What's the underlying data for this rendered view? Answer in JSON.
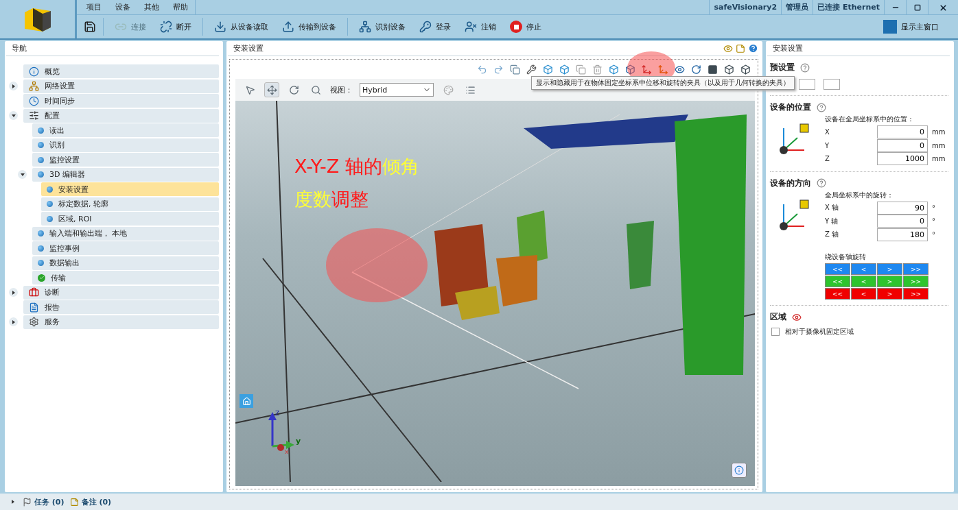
{
  "menu": [
    "项目",
    "设备",
    "其他",
    "帮助"
  ],
  "toolbar": [
    {
      "label": "连接",
      "disabled": true
    },
    {
      "label": "断开",
      "disabled": false
    },
    {
      "label": "从设备读取",
      "disabled": false
    },
    {
      "label": "传输到设备",
      "disabled": false
    },
    {
      "label": "识别设备",
      "disabled": false
    },
    {
      "label": "登录",
      "disabled": false
    },
    {
      "label": "注销",
      "disabled": false
    },
    {
      "label": "停止",
      "disabled": false
    }
  ],
  "status_cells": [
    "safeVisionary2",
    "管理员",
    "已连接 Ethernet"
  ],
  "show_main_window": "显示主窗口",
  "navigation": {
    "title": "导航",
    "items": [
      {
        "kind": "overview",
        "label": "概览",
        "selected": false
      },
      {
        "kind": "network",
        "label": "网络设置",
        "selected": false,
        "expanded": false
      },
      {
        "kind": "clock",
        "label": "时间同步",
        "selected": false
      },
      {
        "kind": "config",
        "label": "配置",
        "selected": false,
        "expanded": true,
        "children": [
          {
            "kind": "step",
            "label": "读出",
            "selected": false
          },
          {
            "kind": "step",
            "label": "识别",
            "selected": false
          },
          {
            "kind": "step",
            "label": "监控设置",
            "selected": false
          },
          {
            "kind": "step",
            "label": "3D 编辑器",
            "selected": false,
            "expanded": true,
            "children": [
              {
                "kind": "step",
                "label": "安装设置",
                "selected": true
              },
              {
                "kind": "step",
                "label": "标定数据, 轮廓",
                "selected": false
              },
              {
                "kind": "step",
                "label": "区域, ROI",
                "selected": false
              }
            ]
          },
          {
            "kind": "step",
            "label": "输入端和输出端， 本地",
            "selected": false
          },
          {
            "kind": "step",
            "label": "监控事例",
            "selected": false
          },
          {
            "kind": "step",
            "label": "数据输出",
            "selected": false
          },
          {
            "kind": "done",
            "label": "传输",
            "selected": false
          }
        ]
      },
      {
        "kind": "diagnose",
        "label": "诊断",
        "selected": false,
        "expanded": false
      },
      {
        "kind": "report",
        "label": "报告",
        "selected": false
      },
      {
        "kind": "service",
        "label": "服务",
        "selected": false,
        "expanded": false
      }
    ]
  },
  "editor": {
    "title": "安装设置",
    "view_label": "视图：",
    "view_value": "Hybrid",
    "tooltip": "显示和隐藏用于在物体固定坐标系中位移和旋转的夹具（以及用于几何转换的夹具）",
    "annotation": [
      [
        {
          "text": "X-Y-Z 轴的",
          "color": "#ff1a1a"
        },
        {
          "text": "倾角",
          "color": "#ffff33"
        }
      ],
      [
        {
          "text": "度数",
          "color": "#ffff33"
        },
        {
          "text": "调整",
          "color": "#ff1a1a"
        }
      ]
    ],
    "gizmo_labels": [
      "Z",
      "y",
      "x"
    ]
  },
  "settings": {
    "title": "安装设置",
    "preset": {
      "title": "预设置"
    },
    "position": {
      "title": "设备的位置",
      "caption": "设备在全局坐标系中的位置：",
      "fields": [
        {
          "label": "X",
          "value": "0",
          "unit": "mm"
        },
        {
          "label": "Y",
          "value": "0",
          "unit": "mm"
        },
        {
          "label": "Z",
          "value": "1000",
          "unit": "mm"
        }
      ]
    },
    "orientation": {
      "title": "设备的方向",
      "caption": "全局坐标系中的旋转：",
      "fields": [
        {
          "label": "X 轴",
          "value": "90",
          "unit": "°"
        },
        {
          "label": "Y 轴",
          "value": "0",
          "unit": "°"
        },
        {
          "label": "Z 轴",
          "value": "180",
          "unit": "°"
        }
      ],
      "rotate_caption": "绕设备轴旋转",
      "rotate_rows": [
        {
          "color": "#1e88f0",
          "buttons": [
            "<<",
            "<",
            ">",
            ">>"
          ]
        },
        {
          "color": "#2ec42e",
          "buttons": [
            "<<",
            "<",
            ">",
            ">>"
          ]
        },
        {
          "color": "#f00000",
          "buttons": [
            "<<",
            "<",
            ">",
            ">>"
          ]
        }
      ]
    },
    "area": {
      "title": "区域",
      "checkbox": {
        "label": "相对于摄像机固定区域",
        "checked": false
      }
    }
  },
  "status_bar": [
    "任务 (0)",
    "备注 (0)"
  ]
}
